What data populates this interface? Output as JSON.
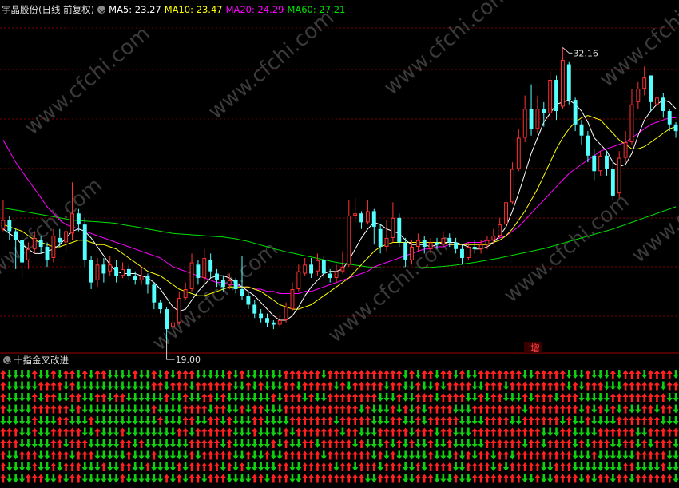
{
  "header": {
    "title": "宇晶股份(日线 前复权)",
    "ma5_label": "MA5: 23.27",
    "ma10_label": "MA10: 23.47",
    "ma20_label": "MA20: 24.29",
    "ma60_label": "MA60: 27.21"
  },
  "indicator": {
    "title": "十指金叉改进",
    "rows": 10,
    "columns": 108
  },
  "annotations": {
    "high_label": "32.16",
    "low_label": "19.00",
    "signal_label": "增"
  },
  "watermark": "www.cfchi.com",
  "colors": {
    "up": "#ff3232",
    "down": "#54ffff",
    "ma5": "#ffffff",
    "ma10": "#ffff00",
    "ma20": "#ff00ff",
    "ma60": "#00e000",
    "grid": "#7a0000",
    "arrow_up": "#ff2020",
    "arrow_down": "#10d010"
  },
  "chart_data": {
    "type": "candlestick",
    "title": "宇晶股份(日线 前复权)",
    "y_range": [
      18.5,
      33.5
    ],
    "price_high": 32.16,
    "price_low": 19.0,
    "candles": [
      [
        24.0,
        24.4,
        25.3,
        23.9
      ],
      [
        24.4,
        23.9,
        24.6,
        23.5
      ],
      [
        23.9,
        23.5,
        24.0,
        22.2
      ],
      [
        23.5,
        22.5,
        23.8,
        21.8
      ],
      [
        22.6,
        23.1,
        23.4,
        22.2
      ],
      [
        23.1,
        23.6,
        23.9,
        22.9
      ],
      [
        23.5,
        23.2,
        23.7,
        22.9
      ],
      [
        23.2,
        22.6,
        23.4,
        22.3
      ],
      [
        22.7,
        23.7,
        24.0,
        22.5
      ],
      [
        23.6,
        23.4,
        24.0,
        23.2
      ],
      [
        23.4,
        23.9,
        24.3,
        23.0
      ],
      [
        23.8,
        24.7,
        26.1,
        23.5
      ],
      [
        24.7,
        24.2,
        24.9,
        23.9
      ],
      [
        24.2,
        22.6,
        24.5,
        22.3
      ],
      [
        22.6,
        21.6,
        22.8,
        21.3
      ],
      [
        21.7,
        22.4,
        22.7,
        21.4
      ],
      [
        22.4,
        22.0,
        22.7,
        21.6
      ],
      [
        22.1,
        22.4,
        22.8,
        21.9
      ],
      [
        22.3,
        21.9,
        22.6,
        21.6
      ],
      [
        21.9,
        22.2,
        22.5,
        21.8
      ],
      [
        22.2,
        21.9,
        22.4,
        21.7
      ],
      [
        21.9,
        21.7,
        22.1,
        21.5
      ],
      [
        21.7,
        21.9,
        22.3,
        21.5
      ],
      [
        21.9,
        21.5,
        22.0,
        21.1
      ],
      [
        21.5,
        20.7,
        21.6,
        20.4
      ],
      [
        20.7,
        20.4,
        20.8,
        20.2
      ],
      [
        20.4,
        19.5,
        20.5,
        19.0
      ],
      [
        19.6,
        19.8,
        20.6,
        19.4
      ],
      [
        19.8,
        20.9,
        21.2,
        19.7
      ],
      [
        20.9,
        21.3,
        21.6,
        20.8
      ],
      [
        21.3,
        22.5,
        22.9,
        21.2
      ],
      [
        22.4,
        21.8,
        22.6,
        21.5
      ],
      [
        21.8,
        22.7,
        23.1,
        21.5
      ],
      [
        22.6,
        22.1,
        22.9,
        21.8
      ],
      [
        22.0,
        21.7,
        22.2,
        21.4
      ],
      [
        21.7,
        21.4,
        21.9,
        21.2
      ],
      [
        21.5,
        21.7,
        22.0,
        21.3
      ],
      [
        21.7,
        21.3,
        21.8,
        21.1
      ],
      [
        21.3,
        21.0,
        22.8,
        20.8
      ],
      [
        21.0,
        20.6,
        21.2,
        20.4
      ],
      [
        20.6,
        20.2,
        20.8,
        20.0
      ],
      [
        20.2,
        20.0,
        20.4,
        19.8
      ],
      [
        20.0,
        19.8,
        20.2,
        19.6
      ],
      [
        19.8,
        19.7,
        19.9,
        19.5
      ],
      [
        19.7,
        19.9,
        20.1,
        19.6
      ],
      [
        19.9,
        20.5,
        20.7,
        19.8
      ],
      [
        20.4,
        21.3,
        21.6,
        20.3
      ],
      [
        21.3,
        22.1,
        22.4,
        21.2
      ],
      [
        22.0,
        22.4,
        22.7,
        21.9
      ],
      [
        22.4,
        22.0,
        22.7,
        21.8
      ],
      [
        22.1,
        22.6,
        22.9,
        21.9
      ],
      [
        22.6,
        22.0,
        22.8,
        21.8
      ],
      [
        22.0,
        21.8,
        22.2,
        21.6
      ],
      [
        21.8,
        22.1,
        22.4,
        21.6
      ],
      [
        22.1,
        22.3,
        23.0,
        22.0
      ],
      [
        22.4,
        24.6,
        25.3,
        22.3
      ],
      [
        24.6,
        24.7,
        25.4,
        24.3
      ],
      [
        24.7,
        24.3,
        24.8,
        24.0
      ],
      [
        24.3,
        24.8,
        25.3,
        24.2
      ],
      [
        24.8,
        24.1,
        24.9,
        23.3
      ],
      [
        24.0,
        23.2,
        24.2,
        22.9
      ],
      [
        23.2,
        23.6,
        24.4,
        23.0
      ],
      [
        23.6,
        24.5,
        25.2,
        23.4
      ],
      [
        24.5,
        23.4,
        24.7,
        23.2
      ],
      [
        23.4,
        22.6,
        23.6,
        22.3
      ],
      [
        22.6,
        23.2,
        23.5,
        22.4
      ],
      [
        23.2,
        23.5,
        23.8,
        23.0
      ],
      [
        23.5,
        23.2,
        23.7,
        22.9
      ],
      [
        23.1,
        23.4,
        23.6,
        22.9
      ],
      [
        23.4,
        23.3,
        23.6,
        23.1
      ],
      [
        23.3,
        23.6,
        23.9,
        23.2
      ],
      [
        23.6,
        23.4,
        23.8,
        23.2
      ],
      [
        23.4,
        23.1,
        23.6,
        22.9
      ],
      [
        23.1,
        22.7,
        23.3,
        22.4
      ],
      [
        22.7,
        23.2,
        23.4,
        22.6
      ],
      [
        23.2,
        23.1,
        23.5,
        22.9
      ],
      [
        23.1,
        23.3,
        23.5,
        22.9
      ],
      [
        23.3,
        23.5,
        23.7,
        23.1
      ],
      [
        23.5,
        23.7,
        24.0,
        23.3
      ],
      [
        23.7,
        24.2,
        24.5,
        23.6
      ],
      [
        24.2,
        25.2,
        25.5,
        24.1
      ],
      [
        25.2,
        26.7,
        27.0,
        25.1
      ],
      [
        26.7,
        28.1,
        28.5,
        26.6
      ],
      [
        28.1,
        29.4,
        30.0,
        27.9
      ],
      [
        29.4,
        28.5,
        30.5,
        28.2
      ],
      [
        28.5,
        29.4,
        30.0,
        28.3
      ],
      [
        29.4,
        29.2,
        29.7,
        28.6
      ],
      [
        29.2,
        30.7,
        31.1,
        29.0
      ],
      [
        30.7,
        29.3,
        30.9,
        28.9
      ],
      [
        29.5,
        31.6,
        32.16,
        29.4
      ],
      [
        31.4,
        29.8,
        31.5,
        29.6
      ],
      [
        29.8,
        28.7,
        29.9,
        28.4
      ],
      [
        28.7,
        28.2,
        28.9,
        27.8
      ],
      [
        28.2,
        27.3,
        28.4,
        27.0
      ],
      [
        27.3,
        26.6,
        27.6,
        26.2
      ],
      [
        26.6,
        27.3,
        27.5,
        26.4
      ],
      [
        27.3,
        26.7,
        27.5,
        26.4
      ],
      [
        26.7,
        25.5,
        27.0,
        25.3
      ],
      [
        25.6,
        27.2,
        27.5,
        25.4
      ],
      [
        27.2,
        27.9,
        28.4,
        27.0
      ],
      [
        27.9,
        29.6,
        30.3,
        27.8
      ],
      [
        29.7,
        30.3,
        30.6,
        29.4
      ],
      [
        30.3,
        30.8,
        31.3,
        30.0
      ],
      [
        30.9,
        29.7,
        30.9,
        29.3
      ],
      [
        29.6,
        29.9,
        30.3,
        29.4
      ],
      [
        29.9,
        29.3,
        30.1,
        29.0
      ],
      [
        29.3,
        28.7,
        29.4,
        28.4
      ],
      [
        28.7,
        28.4,
        28.8,
        28.1
      ]
    ],
    "ma5": [
      24.0,
      23.8,
      23.6,
      23.3,
      23.1,
      22.9,
      22.9,
      23.0,
      23.1,
      23.3,
      23.6,
      23.9,
      24.0,
      23.9,
      23.6,
      23.2,
      22.8,
      22.4,
      22.1,
      22.0,
      22.0,
      22.0,
      21.9,
      21.8,
      21.6,
      21.3,
      20.9,
      20.5,
      20.3,
      20.4,
      20.8,
      21.2,
      21.5,
      21.8,
      21.9,
      21.9,
      21.8,
      21.6,
      21.4,
      21.2,
      21.0,
      20.7,
      20.4,
      20.1,
      19.9,
      19.9,
      20.1,
      20.5,
      21.0,
      21.4,
      21.7,
      22.0,
      22.1,
      22.1,
      22.2,
      22.6,
      23.1,
      23.6,
      24.0,
      24.3,
      24.2,
      24.0,
      23.9,
      23.8,
      23.5,
      23.3,
      23.3,
      23.3,
      23.2,
      23.3,
      23.4,
      23.4,
      23.4,
      23.3,
      23.2,
      23.1,
      23.1,
      23.2,
      23.4,
      23.7,
      24.1,
      24.8,
      25.6,
      26.5,
      27.4,
      28.1,
      28.8,
      29.2,
      29.6,
      29.7,
      29.8,
      29.6,
      29.3,
      28.8,
      28.1,
      27.8,
      27.5,
      27.0,
      26.8,
      26.9,
      27.4,
      28.2,
      28.9,
      29.3,
      29.6,
      29.8,
      29.7,
      29.4
    ],
    "ma10": [
      24.2,
      24.1,
      24.0,
      23.9,
      23.7,
      23.5,
      23.4,
      23.3,
      23.2,
      23.2,
      23.3,
      23.4,
      23.5,
      23.5,
      23.4,
      23.3,
      23.3,
      23.2,
      23.1,
      22.9,
      22.7,
      22.5,
      22.3,
      22.1,
      22.0,
      21.9,
      21.7,
      21.5,
      21.3,
      21.2,
      21.1,
      21.0,
      21.0,
      21.1,
      21.2,
      21.3,
      21.4,
      21.4,
      21.4,
      21.4,
      21.3,
      21.2,
      21.0,
      20.8,
      20.6,
      20.5,
      20.4,
      20.4,
      20.5,
      20.6,
      20.8,
      21.0,
      21.2,
      21.4,
      21.6,
      21.8,
      22.1,
      22.4,
      22.7,
      23.0,
      23.2,
      23.3,
      23.4,
      23.4,
      23.4,
      23.4,
      23.4,
      23.4,
      23.4,
      23.4,
      23.4,
      23.3,
      23.3,
      23.3,
      23.3,
      23.3,
      23.3,
      23.3,
      23.4,
      23.5,
      23.7,
      24.0,
      24.4,
      24.8,
      25.3,
      25.8,
      26.4,
      27.0,
      27.6,
      28.1,
      28.5,
      28.8,
      29.0,
      29.1,
      29.0,
      28.9,
      28.6,
      28.3,
      28.0,
      27.8,
      27.6,
      27.6,
      27.7,
      27.9,
      28.1,
      28.3,
      28.5,
      28.6
    ],
    "ma20": [
      28.0,
      27.5,
      27.0,
      26.6,
      26.2,
      25.8,
      25.4,
      25.0,
      24.7,
      24.4,
      24.2,
      24.1,
      24.0,
      23.9,
      23.8,
      23.7,
      23.6,
      23.5,
      23.4,
      23.3,
      23.2,
      23.1,
      23.0,
      22.9,
      22.8,
      22.7,
      22.5,
      22.3,
      22.2,
      22.1,
      22.0,
      21.9,
      21.8,
      21.7,
      21.6,
      21.6,
      21.5,
      21.5,
      21.4,
      21.4,
      21.3,
      21.3,
      21.2,
      21.2,
      21.1,
      21.1,
      21.1,
      21.1,
      21.2,
      21.2,
      21.3,
      21.4,
      21.5,
      21.6,
      21.7,
      21.8,
      21.9,
      22.0,
      22.1,
      22.3,
      22.4,
      22.5,
      22.6,
      22.7,
      22.8,
      22.9,
      23.0,
      23.1,
      23.1,
      23.2,
      23.2,
      23.3,
      23.3,
      23.3,
      23.4,
      23.4,
      23.4,
      23.5,
      23.5,
      23.6,
      23.7,
      23.9,
      24.1,
      24.4,
      24.7,
      25.0,
      25.3,
      25.6,
      25.9,
      26.2,
      26.5,
      26.7,
      26.9,
      27.1,
      27.3,
      27.5,
      27.6,
      27.7,
      27.8,
      27.9,
      28.1,
      28.3,
      28.5,
      28.7,
      28.8,
      28.9,
      29.0,
      29.0
    ],
    "ma60": [
      24.95,
      24.9,
      24.85,
      24.8,
      24.75,
      24.7,
      24.65,
      24.6,
      24.55,
      24.5,
      24.45,
      24.4,
      24.38,
      24.36,
      24.34,
      24.32,
      24.3,
      24.28,
      24.25,
      24.2,
      24.15,
      24.1,
      24.05,
      24.0,
      23.95,
      23.9,
      23.85,
      23.8,
      23.78,
      23.76,
      23.74,
      23.72,
      23.7,
      23.68,
      23.66,
      23.64,
      23.6,
      23.56,
      23.5,
      23.44,
      23.36,
      23.28,
      23.2,
      23.12,
      23.05,
      22.98,
      22.92,
      22.86,
      22.8,
      22.74,
      22.68,
      22.62,
      22.56,
      22.5,
      22.46,
      22.42,
      22.38,
      22.34,
      22.3,
      22.28,
      22.26,
      22.25,
      22.25,
      22.25,
      22.25,
      22.25,
      22.26,
      22.27,
      22.28,
      22.3,
      22.32,
      22.35,
      22.38,
      22.42,
      22.46,
      22.5,
      22.55,
      22.6,
      22.65,
      22.7,
      22.76,
      22.82,
      22.88,
      22.94,
      23.0,
      23.06,
      23.12,
      23.2,
      23.28,
      23.36,
      23.44,
      23.52,
      23.6,
      23.68,
      23.76,
      23.84,
      23.92,
      24.0,
      24.1,
      24.2,
      24.3,
      24.4,
      24.5,
      24.6,
      24.7,
      24.8,
      24.9,
      25.0
    ]
  }
}
